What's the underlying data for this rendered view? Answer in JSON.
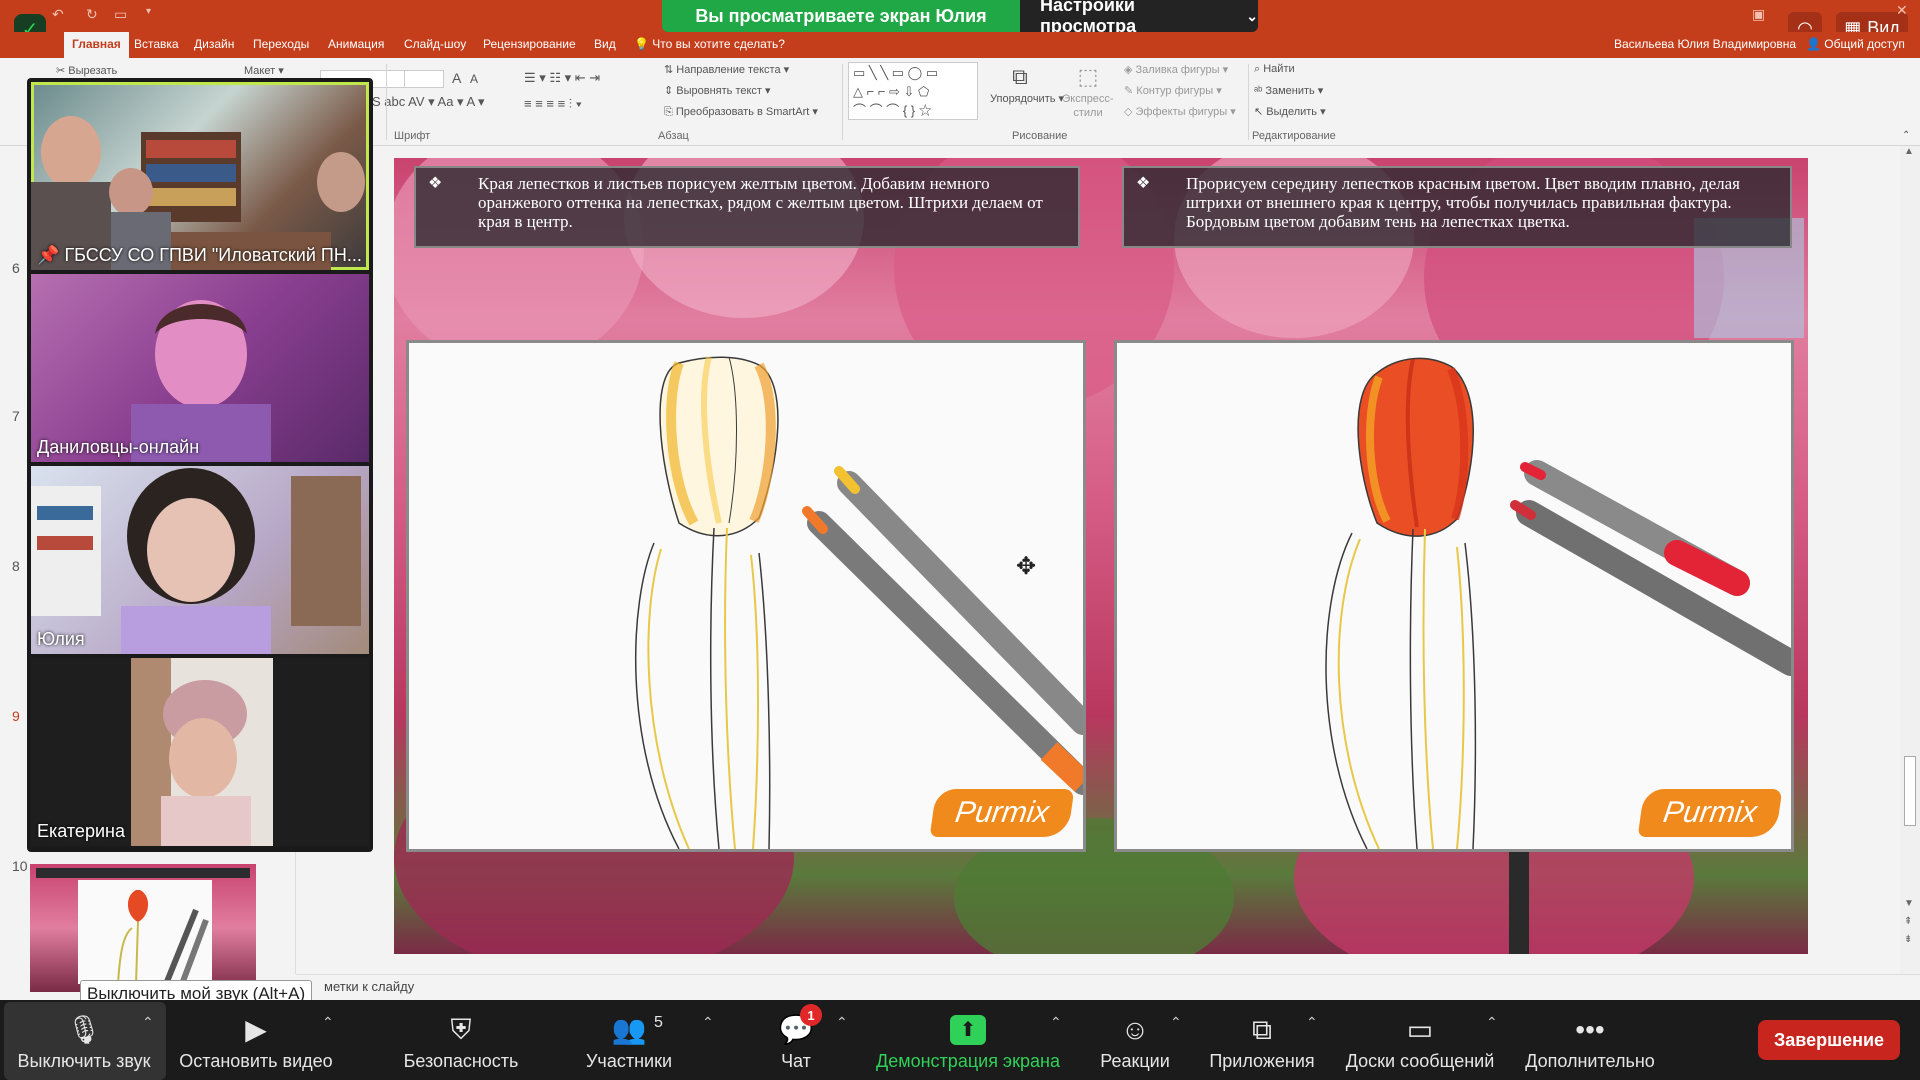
{
  "zoom_banner": {
    "viewing_text": "Вы просматриваете экран Юлия",
    "settings_text": "Настройки просмотра"
  },
  "titlebar": {
    "view_button": "Вид"
  },
  "ribbon_tabs": [
    "Главная",
    "Вставка",
    "Дизайн",
    "Переходы",
    "Анимация",
    "Слайд-шоу",
    "Рецензирование",
    "Вид"
  ],
  "ribbon_search": "Что вы хотите сделать?",
  "user_name": "Васильева Юлия Владимировна",
  "share_access": "Общий доступ",
  "ribbon": {
    "cut": "Вырезать",
    "layout": "Макет",
    "text_direction": "Направление текста",
    "align_text": "Выровнять текст",
    "convert_smartart": "Преобразовать в SmartArt",
    "arrange": "Упорядочить",
    "express_styles": "Экспресс-стили",
    "shape_fill": "Заливка фигуры",
    "shape_outline": "Контур фигуры",
    "shape_effects": "Эффекты фигуры",
    "find": "Найти",
    "replace": "Заменить",
    "select": "Выделить",
    "group_font": "Шрифт",
    "group_paragraph": "Абзац",
    "group_drawing": "Рисование",
    "group_editing": "Редактирование"
  },
  "thumbnails": {
    "numbers": [
      "6",
      "7",
      "8",
      "9",
      "10"
    ]
  },
  "slide": {
    "left_text": "Края лепестков и листьев порисуем желтым цветом. Добавим немного оранжевого оттенка на лепестках, рядом с желтым цветом. Штрихи делаем от края в центр.",
    "right_text": "Прорисуем середину лепестков красным цветом. Цвет вводим плавно, делая штрихи от внешнего края к центру, чтобы получилась правильная фактура. Бордовым цветом добавим тень на лепестках цветка.",
    "watermark": "Purmix"
  },
  "notes_placeholder": "метки к слайду",
  "participants": [
    {
      "name": "ГБССУ СО ГПВИ \"Иловатский ПН...",
      "pinned": true
    },
    {
      "name": "Даниловцы-онлайн"
    },
    {
      "name": "Юлия"
    },
    {
      "name": "Екатерина"
    }
  ],
  "tooltip": "Выключить мой звук (Alt+A)",
  "zoom_controls": {
    "mute": "Выключить звук",
    "video": "Остановить видео",
    "security": "Безопасность",
    "participants": "Участники",
    "participants_count": "5",
    "chat": "Чат",
    "chat_badge": "1",
    "share": "Демонстрация экрана",
    "reactions": "Реакции",
    "apps": "Приложения",
    "whiteboards": "Доски сообщений",
    "more": "Дополнительно",
    "end": "Завершение"
  },
  "colors": {
    "ppt_accent": "#c43e1c",
    "zoom_green": "#1fa845",
    "zoom_end": "#c8251f",
    "speaking_outline": "#c0e84c"
  }
}
